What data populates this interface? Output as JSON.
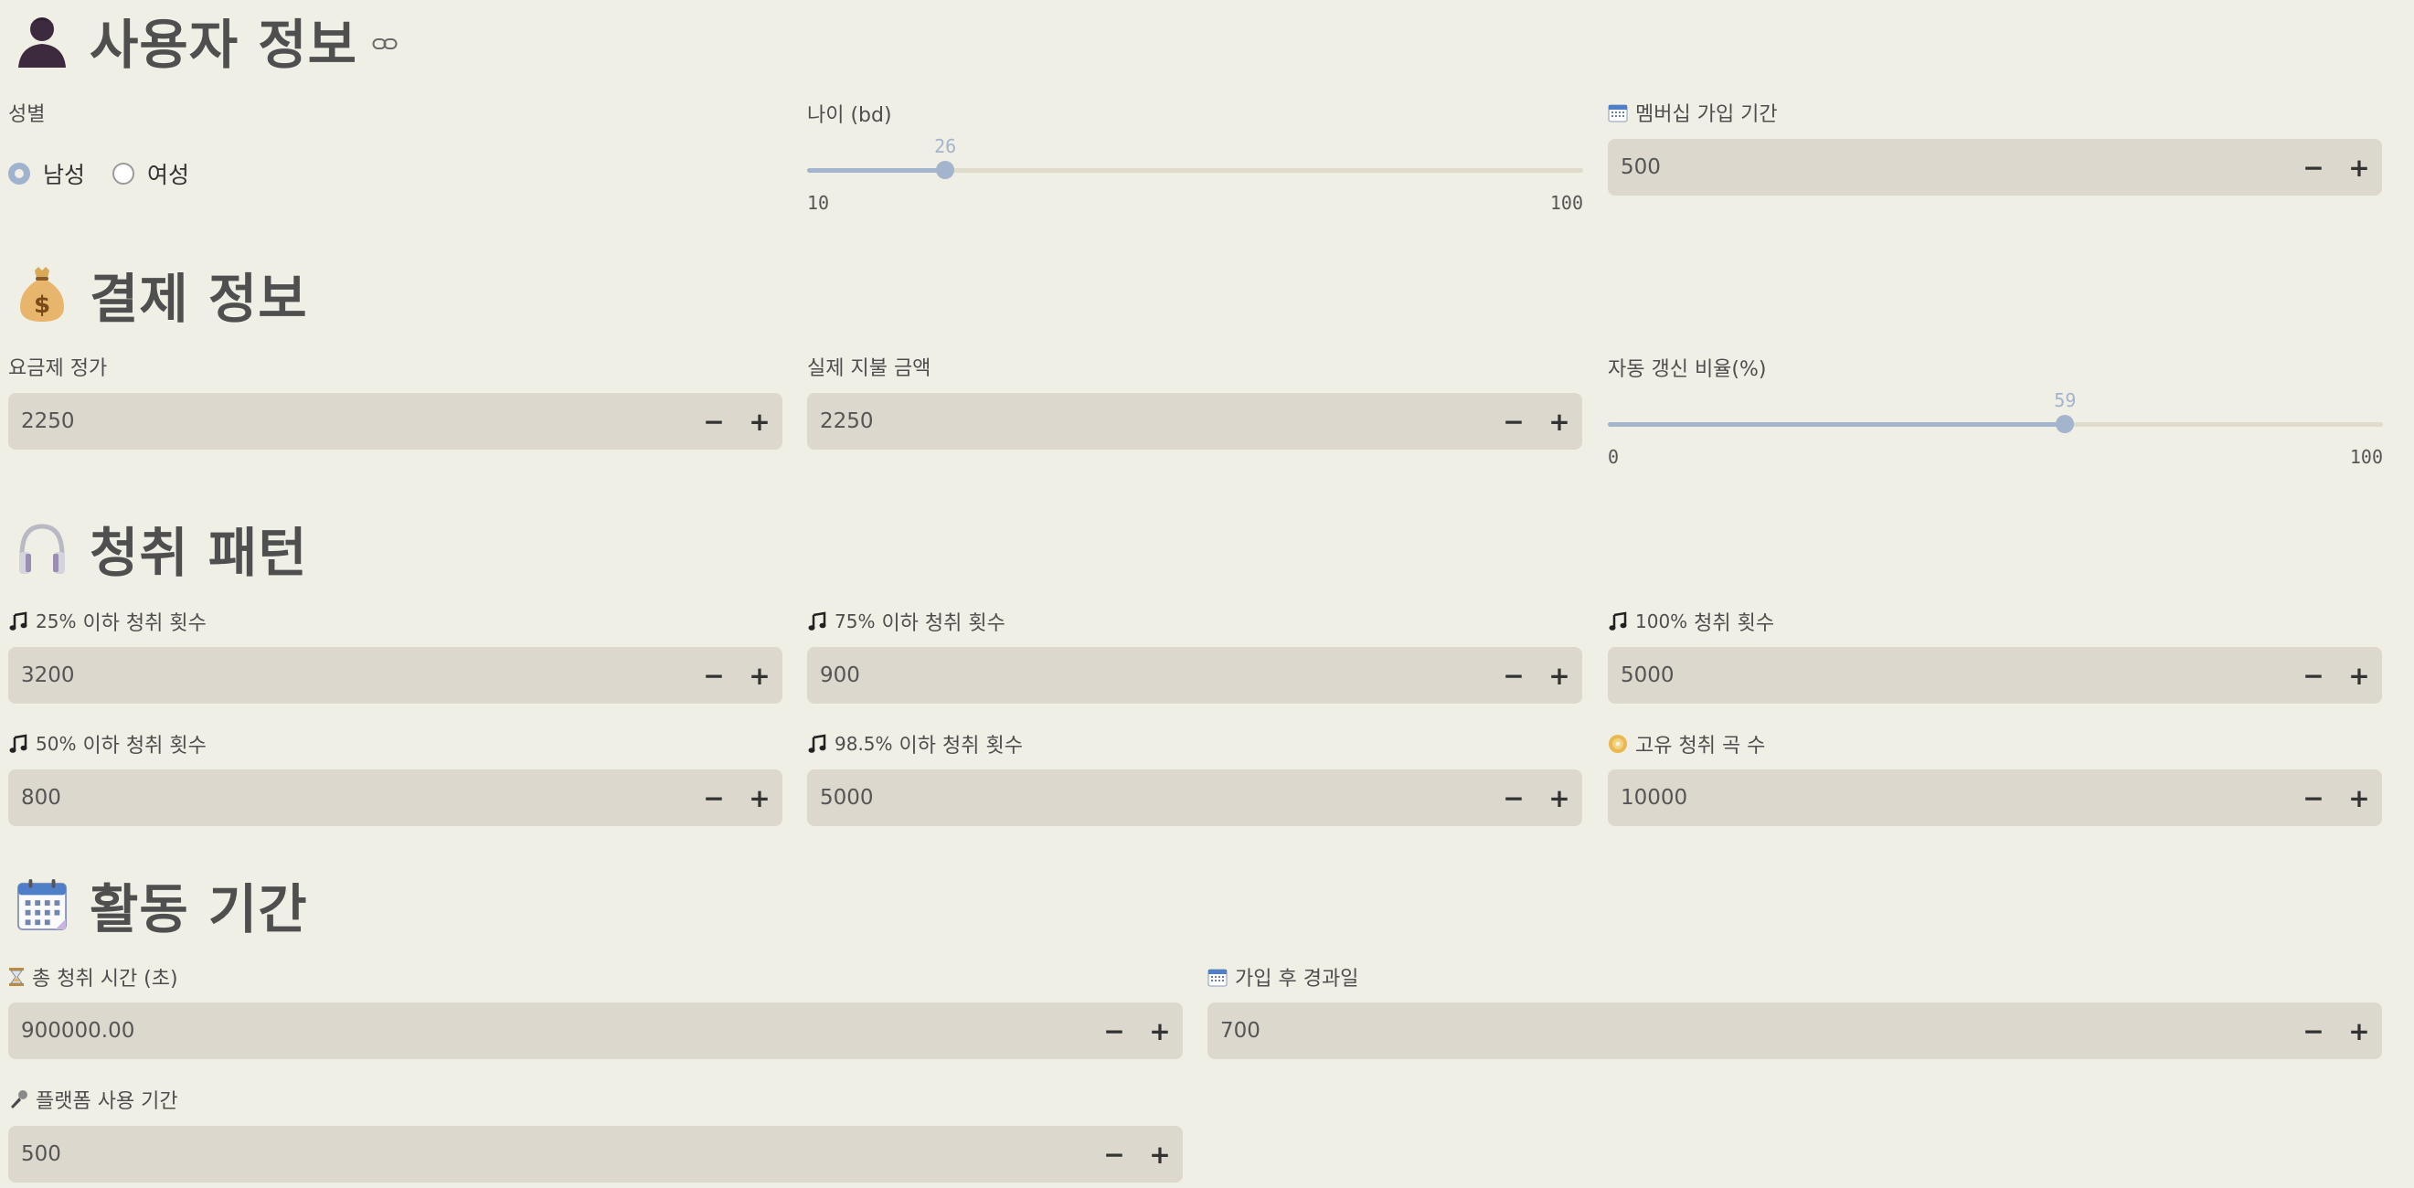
{
  "sections": {
    "user": {
      "title": "사용자 정보"
    },
    "payment": {
      "title": "결제 정보"
    },
    "listening": {
      "title": "청취 패턴"
    },
    "activity": {
      "title": "활동 기간"
    }
  },
  "user": {
    "gender_label": "성별",
    "gender_options": [
      "남성",
      "여성"
    ],
    "gender_selected": "남성",
    "age_label": "나이 (bd)",
    "age_value": "26",
    "age_min": "10",
    "age_max": "100",
    "age_fraction": 0.178,
    "membership_label": "멤버십 가입 기간",
    "membership_value": "500"
  },
  "payment": {
    "plan_price_label": "요금제 정가",
    "plan_price_value": "2250",
    "actual_paid_label": "실제 지불 금액",
    "actual_paid_value": "2250",
    "auto_renew_label": "자동 갱신 비율(%)",
    "auto_renew_value": "59",
    "auto_renew_min": "0",
    "auto_renew_max": "100",
    "auto_renew_fraction": 0.59
  },
  "listening": {
    "p25_prefix": "25%",
    "p25_label": " 이하 청취 횟수",
    "p25_value": "3200",
    "p75_prefix": "75%",
    "p75_label": " 이하 청취 횟수",
    "p75_value": "900",
    "p100_prefix": "100%",
    "p100_label": " 청취 횟수",
    "p100_value": "5000",
    "p50_prefix": "50%",
    "p50_label": " 이하 청취 횟수",
    "p50_value": "800",
    "p985_prefix": "98.5%",
    "p985_label": " 이하 청취 횟수",
    "p985_value": "5000",
    "unique_label": "고유 청취 곡 수",
    "unique_value": "10000"
  },
  "activity": {
    "total_time_label": "총 청취 시간 (초)",
    "total_time_value": "900000.00",
    "days_since_label": "가입 후 경과일",
    "days_since_value": "700",
    "platform_label": "플랫폼 사용 기간",
    "platform_value": "500"
  },
  "buttons": {
    "minus": "−",
    "plus": "+"
  },
  "colors": {
    "background": "#f0efe5",
    "input_bg": "#dcd8cd",
    "accent": "#a3b4cc"
  },
  "icons": {
    "user": "person-silhouette-icon",
    "payment": "money-bag-icon",
    "listening": "headphones-icon",
    "activity": "calendar-icon",
    "link": "link-icon",
    "music": "music-note-icon",
    "disc": "dvd-icon",
    "hourglass": "hourglass-icon",
    "mic": "microphone-icon"
  }
}
